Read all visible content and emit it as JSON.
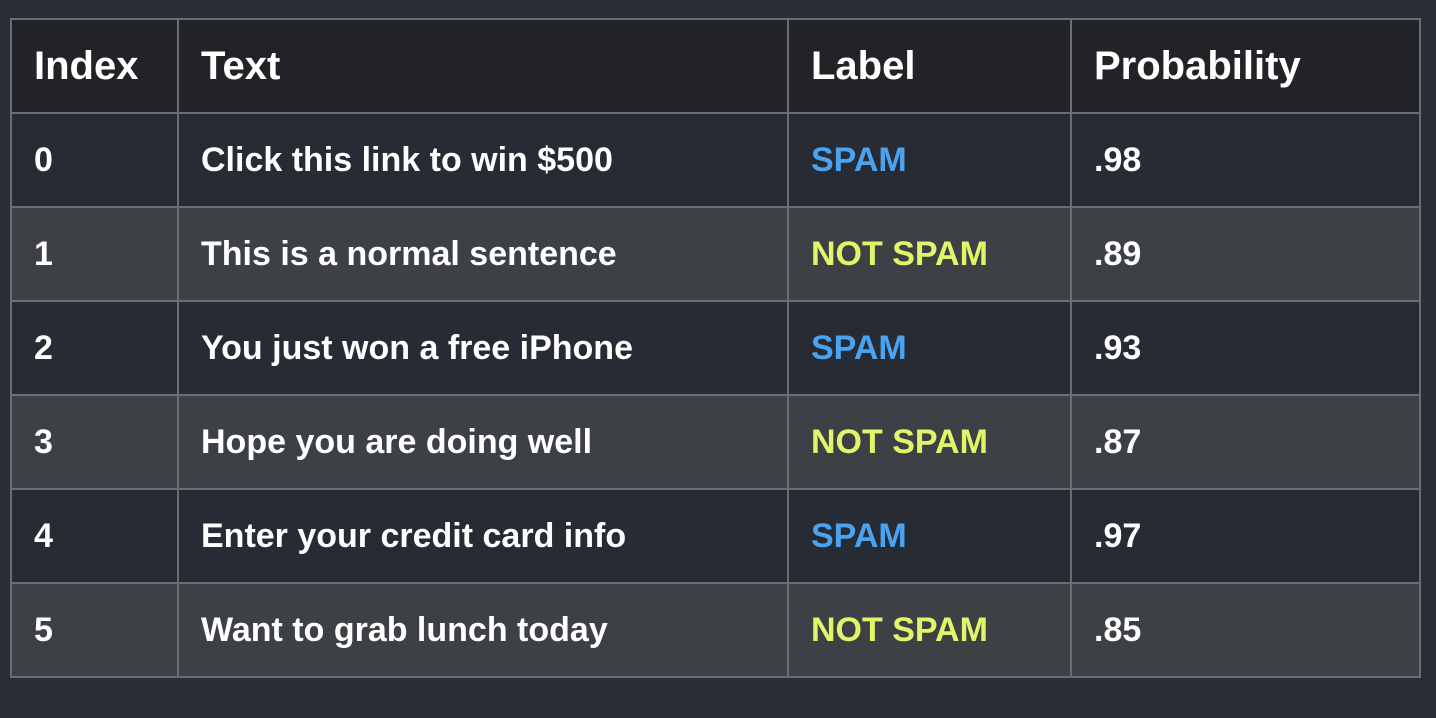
{
  "table": {
    "headers": [
      "Index",
      "Text",
      "Label",
      "Probability"
    ],
    "rows": [
      {
        "index": "0",
        "text": "Click this link to win $500",
        "label": "SPAM",
        "probability": ".98"
      },
      {
        "index": "1",
        "text": "This is a normal sentence",
        "label": "NOT SPAM",
        "probability": ".89"
      },
      {
        "index": "2",
        "text": "You just won a free iPhone",
        "label": "SPAM",
        "probability": ".93"
      },
      {
        "index": "3",
        "text": "Hope you are doing well",
        "label": "NOT SPAM",
        "probability": ".87"
      },
      {
        "index": "4",
        "text": "Enter your credit card info",
        "label": "SPAM",
        "probability": ".97"
      },
      {
        "index": "5",
        "text": "Want to grab lunch today",
        "label": "NOT SPAM",
        "probability": ".85"
      }
    ]
  },
  "colors": {
    "background": "#2a2d35",
    "header_background": "#222327",
    "row_dark": "#272b33",
    "row_light": "#3d4146",
    "spam_label": "#4aa3f0",
    "not_spam_label": "#e0f56a",
    "border": "#6a6d72"
  }
}
